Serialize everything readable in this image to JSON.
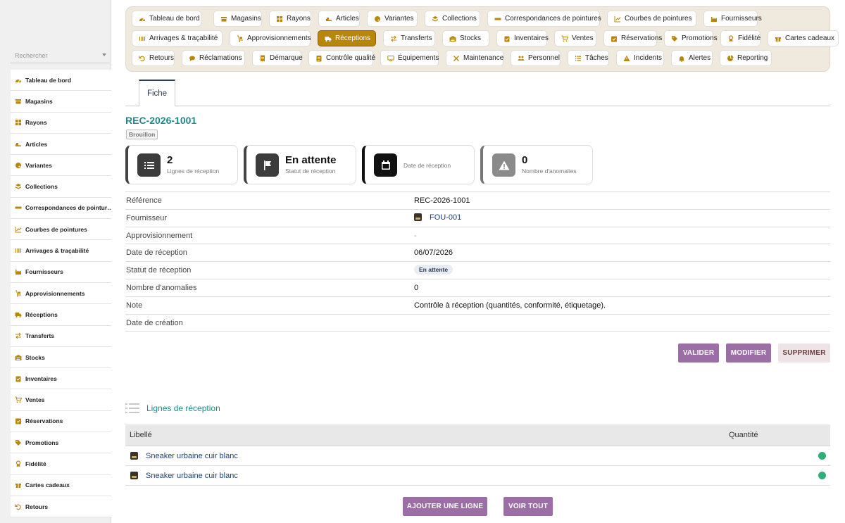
{
  "sidebar": {
    "search_placeholder": "Rechercher",
    "items": [
      {
        "label": "Tableau de bord",
        "icon": "gauge-icon"
      },
      {
        "label": "Magasins",
        "icon": "store-icon"
      },
      {
        "label": "Rayons",
        "icon": "grid-icon"
      },
      {
        "label": "Articles",
        "icon": "shoe-icon"
      },
      {
        "label": "Variantes",
        "icon": "palette-icon"
      },
      {
        "label": "Collections",
        "icon": "layers-icon"
      },
      {
        "label": "Correspondances de pointur…",
        "icon": "ruler-icon"
      },
      {
        "label": "Courbes de pointures",
        "icon": "chart-icon"
      },
      {
        "label": "Arrivages & traçabilité",
        "icon": "barcode-icon"
      },
      {
        "label": "Fournisseurs",
        "icon": "factory-icon"
      },
      {
        "label": "Approvisionnements",
        "icon": "dolly-icon"
      },
      {
        "label": "Réceptions",
        "icon": "truck-icon"
      },
      {
        "label": "Transferts",
        "icon": "arrows-icon"
      },
      {
        "label": "Stocks",
        "icon": "warehouse-icon"
      },
      {
        "label": "Inventaires",
        "icon": "clipboard-icon"
      },
      {
        "label": "Ventes",
        "icon": "cart-icon"
      },
      {
        "label": "Réservations",
        "icon": "calendar-check-icon"
      },
      {
        "label": "Promotions",
        "icon": "tag-icon"
      },
      {
        "label": "Fidélité",
        "icon": "medal-icon"
      },
      {
        "label": "Cartes cadeaux",
        "icon": "gift-icon"
      },
      {
        "label": "Retours",
        "icon": "undo-icon"
      }
    ]
  },
  "topnav": {
    "rows": [
      [
        {
          "label": "Tableau de bord",
          "icon": "gauge-icon"
        },
        {
          "label": "Magasins",
          "icon": "store-icon"
        },
        {
          "label": "Rayons",
          "icon": "grid-icon"
        },
        {
          "label": "Articles",
          "icon": "shoe-icon"
        },
        {
          "label": "Variantes",
          "icon": "palette-icon"
        },
        {
          "label": "Collections",
          "icon": "layers-icon"
        },
        {
          "label": "Correspondances de pointures",
          "icon": "ruler-icon"
        },
        {
          "label": "Courbes de pointures",
          "icon": "chart-icon"
        },
        {
          "label": "Fournisseurs",
          "icon": "factory-icon"
        }
      ],
      [
        {
          "label": "Arrivages & traçabilité",
          "icon": "barcode-icon"
        },
        {
          "label": "Approvisionnements",
          "icon": "dolly-icon"
        },
        {
          "label": "Réceptions",
          "icon": "truck-icon",
          "active": true
        },
        {
          "label": "Transferts",
          "icon": "arrows-icon"
        },
        {
          "label": "Stocks",
          "icon": "warehouse-icon"
        },
        {
          "label": "Inventaires",
          "icon": "clipboard-icon"
        },
        {
          "label": "Ventes",
          "icon": "cart-icon"
        },
        {
          "label": "Réservations",
          "icon": "calendar-check-icon"
        },
        {
          "label": "Promotions",
          "icon": "tag-icon"
        },
        {
          "label": "Fidélité",
          "icon": "medal-icon"
        },
        {
          "label": "Cartes cadeaux",
          "icon": "gift-icon"
        }
      ],
      [
        {
          "label": "Retours",
          "icon": "undo-icon"
        },
        {
          "label": "Réclamations",
          "icon": "comment-icon"
        },
        {
          "label": "Démarque",
          "icon": "receipt-icon"
        },
        {
          "label": "Contrôle qualité",
          "icon": "checklist-icon"
        },
        {
          "label": "Équipements",
          "icon": "monitor-icon"
        },
        {
          "label": "Maintenance",
          "icon": "tools-icon"
        },
        {
          "label": "Personnel",
          "icon": "users-icon"
        },
        {
          "label": "Tâches",
          "icon": "list-icon"
        },
        {
          "label": "Incidents",
          "icon": "warning-icon"
        },
        {
          "label": "Alertes",
          "icon": "bell-icon"
        },
        {
          "label": "Reporting",
          "icon": "pie-icon"
        }
      ]
    ]
  },
  "tab": {
    "label": "Fiche"
  },
  "record": {
    "title": "REC-2026-1001",
    "status_badge": "Brouillon"
  },
  "cards": [
    {
      "value": "2",
      "label": "Lignes de réception",
      "icon": "list-icon"
    },
    {
      "value": "En attente",
      "label": "Statut de réception",
      "icon": "flag-icon"
    },
    {
      "value": "",
      "label": "Date de réception",
      "icon": "calendar-icon"
    },
    {
      "value": "0",
      "label": "Nombre d'anomalies",
      "icon": "warning-icon"
    }
  ],
  "fields": {
    "reference": {
      "label": "Référence",
      "value": "REC-2026-1001"
    },
    "fournisseur": {
      "label": "Fournisseur",
      "value": "FOU-001"
    },
    "approvisionnement": {
      "label": "Approvisionnement",
      "value": "-"
    },
    "date_reception": {
      "label": "Date de réception",
      "value": "06/07/2026"
    },
    "statut": {
      "label": "Statut de réception",
      "value": "En attente"
    },
    "anomalies": {
      "label": "Nombre d'anomalies",
      "value": "0"
    },
    "note": {
      "label": "Note",
      "value": "Contrôle à réception (quantités, conformité, étiquetage)."
    },
    "date_creation": {
      "label": "Date de création",
      "value": ""
    }
  },
  "actions": {
    "valider": "VALIDER",
    "modifier": "MODIFIER",
    "supprimer": "SUPPRIMER"
  },
  "lines": {
    "section_title": "Lignes de réception",
    "columns": {
      "libelle": "Libellé",
      "quantite": "Quantité"
    },
    "rows": [
      {
        "label": "Sneaker urbaine cuir blanc"
      },
      {
        "label": "Sneaker urbaine cuir blanc"
      }
    ],
    "add_button": "AJOUTER UNE LIGNE",
    "view_all_button": "VOIR TOUT"
  },
  "colors": {
    "accent": "#b8860b",
    "title": "#1f8a8a",
    "button": "#9b6fa6",
    "status_ok": "#2fae7a"
  }
}
